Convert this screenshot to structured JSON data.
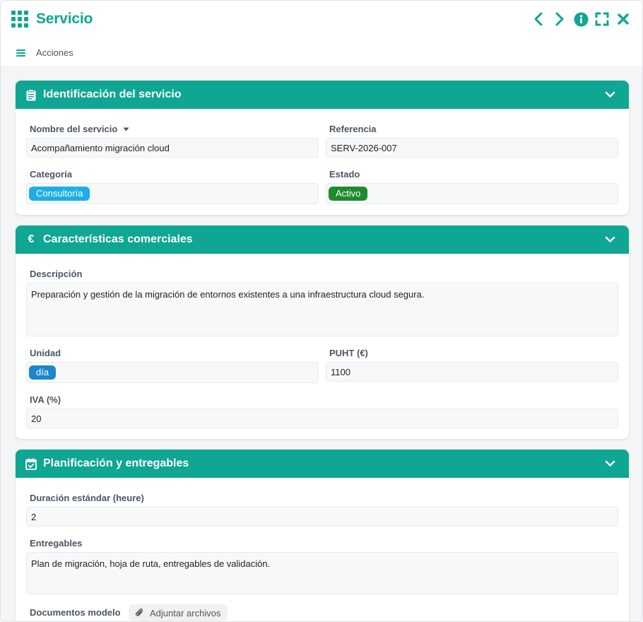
{
  "app": {
    "title": "Servicio",
    "actions_label": "Acciones",
    "accent_color": "#0fa693"
  },
  "title_actions": {
    "icons": [
      "chevron-left-icon",
      "chevron-right-icon",
      "info-icon",
      "fullscreen-icon",
      "close-icon"
    ]
  },
  "sections": {
    "identification": {
      "title": "Identificación del servicio",
      "icon": "clipboard-icon",
      "service_name_label": "Nombre del servicio",
      "service_name_value": "Acompañamiento migración cloud",
      "reference_label": "Referencia",
      "reference_value": "SERV-2026-007",
      "category_label": "Categoría",
      "category_value": "Consultoría",
      "category_color": "#1eaee6",
      "status_label": "Estado",
      "status_value": "Activo",
      "status_color": "#1e8a2e"
    },
    "commercial": {
      "title": "Características comerciales",
      "icon": "euro-icon",
      "description_label": "Descripción",
      "description_value": "Preparación y gestión de la migración de entornos existentes a una infraestructura cloud segura.",
      "unit_label": "Unidad",
      "unit_value": "día",
      "unit_color": "#1b86c9",
      "puht_label": "PUHT (€)",
      "puht_value": "1100",
      "vat_label": "IVA (%)",
      "vat_value": "20"
    },
    "planning": {
      "title": "Planificación y entregables",
      "icon": "calendar-check-icon",
      "duration_label": "Duración estándar (heure)",
      "duration_value": "2",
      "deliverables_label": "Entregables",
      "deliverables_value": "Plan de migración, hoja de ruta, entregables de validación.",
      "documents_label": "Documentos modelo",
      "attach_label": "Adjuntar archivos"
    }
  }
}
